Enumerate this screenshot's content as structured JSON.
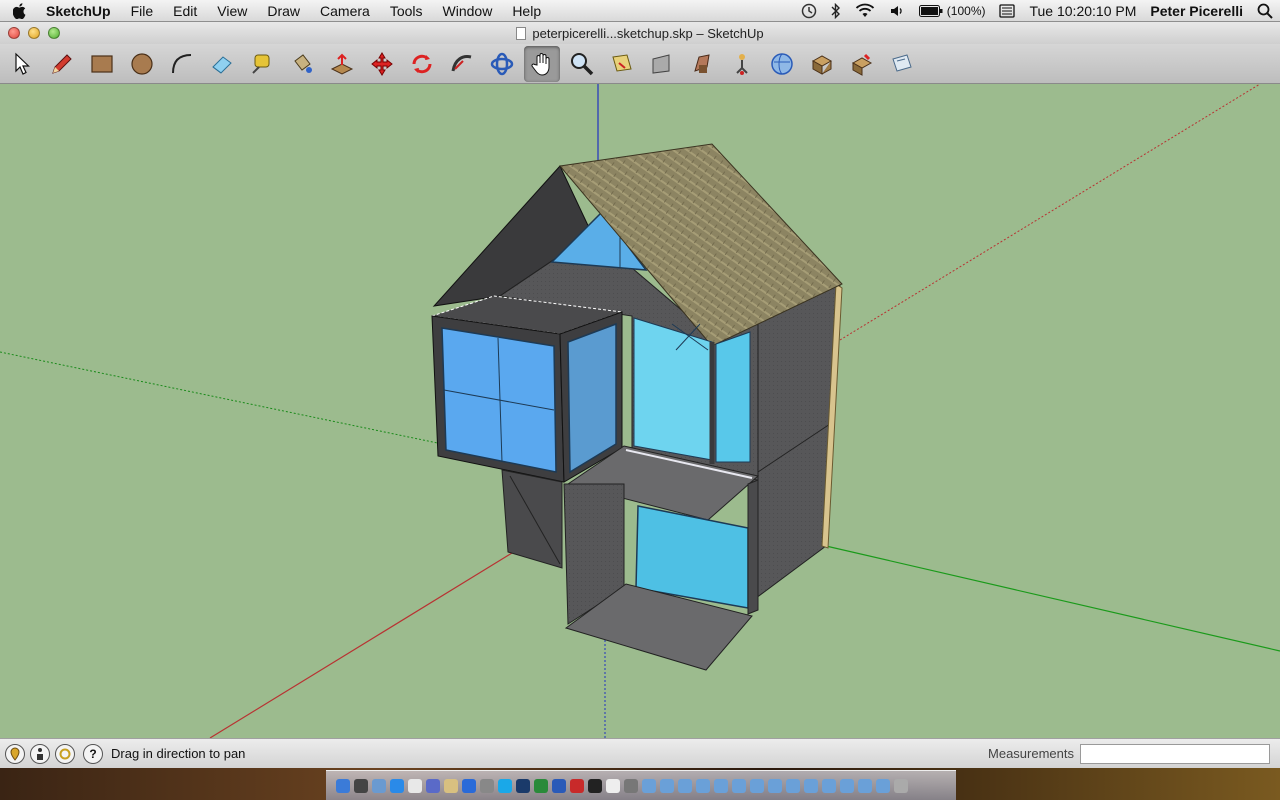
{
  "menubar": {
    "app_name": "SketchUp",
    "menus": [
      "File",
      "Edit",
      "View",
      "Draw",
      "Camera",
      "Tools",
      "Window",
      "Help"
    ],
    "battery": "(100%)",
    "clock": "Tue 10:20:10 PM",
    "user": "Peter Picerelli"
  },
  "window": {
    "title": "peterpicerelli...sketchup.skp – SketchUp"
  },
  "toolbar": {
    "tools": [
      {
        "name": "select-tool",
        "icon": "arrow-icon"
      },
      {
        "name": "line-tool",
        "icon": "pencil-icon"
      },
      {
        "name": "rectangle-tool",
        "icon": "rectangle-icon"
      },
      {
        "name": "circle-tool",
        "icon": "circle-icon"
      },
      {
        "name": "arc-tool",
        "icon": "arc-icon"
      },
      {
        "name": "eraser-tool",
        "icon": "eraser-icon"
      },
      {
        "name": "tape-measure-tool",
        "icon": "tape-icon"
      },
      {
        "name": "paint-bucket-tool",
        "icon": "bucket-icon"
      },
      {
        "name": "push-pull-tool",
        "icon": "push-pull-icon"
      },
      {
        "name": "move-tool",
        "icon": "move-icon"
      },
      {
        "name": "rotate-tool",
        "icon": "rotate-icon"
      },
      {
        "name": "follow-me-tool",
        "icon": "follow-me-icon"
      },
      {
        "name": "orbit-tool",
        "icon": "orbit-icon"
      },
      {
        "name": "pan-tool",
        "icon": "hand-icon"
      },
      {
        "name": "zoom-tool",
        "icon": "magnifier-icon"
      },
      {
        "name": "zoom-extents-tool",
        "icon": "zoom-extents-icon"
      },
      {
        "name": "previous-view-tool",
        "icon": "previous-view-icon"
      },
      {
        "name": "walk-tool",
        "icon": "walk-icon"
      },
      {
        "name": "position-camera-tool",
        "icon": "camera-icon"
      },
      {
        "name": "get-models-tool",
        "icon": "globe-icon"
      },
      {
        "name": "share-model-tool",
        "icon": "share-icon"
      },
      {
        "name": "components-tool",
        "icon": "components-icon"
      },
      {
        "name": "send-to-layout-tool",
        "icon": "layout-icon"
      }
    ],
    "active_tool": "pan-tool"
  },
  "statusbar": {
    "hint": "Drag in direction to pan",
    "measurements_label": "Measurements",
    "measurements_value": ""
  },
  "colors": {
    "ground": "#9cbb8e",
    "axis_red": "#b83232",
    "axis_green": "#1a9a1a",
    "axis_blue": "#2030c0",
    "wall": "#5a5a5c",
    "glass": "#5ab4ec",
    "roof": "#8c8462"
  }
}
